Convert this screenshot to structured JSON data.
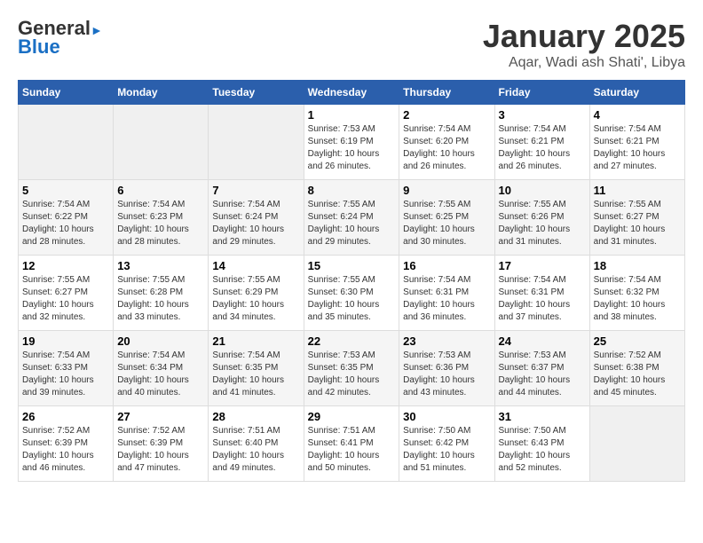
{
  "header": {
    "logo_line1": "General",
    "logo_line2": "Blue",
    "title": "January 2025",
    "subtitle": "Aqar, Wadi ash Shati', Libya"
  },
  "weekdays": [
    "Sunday",
    "Monday",
    "Tuesday",
    "Wednesday",
    "Thursday",
    "Friday",
    "Saturday"
  ],
  "weeks": [
    [
      {
        "day": "",
        "empty": true
      },
      {
        "day": "",
        "empty": true
      },
      {
        "day": "",
        "empty": true
      },
      {
        "day": "1",
        "sunrise": "7:53 AM",
        "sunset": "6:19 PM",
        "daylight": "10 hours and 26 minutes."
      },
      {
        "day": "2",
        "sunrise": "7:54 AM",
        "sunset": "6:20 PM",
        "daylight": "10 hours and 26 minutes."
      },
      {
        "day": "3",
        "sunrise": "7:54 AM",
        "sunset": "6:21 PM",
        "daylight": "10 hours and 26 minutes."
      },
      {
        "day": "4",
        "sunrise": "7:54 AM",
        "sunset": "6:21 PM",
        "daylight": "10 hours and 27 minutes."
      }
    ],
    [
      {
        "day": "5",
        "sunrise": "7:54 AM",
        "sunset": "6:22 PM",
        "daylight": "10 hours and 28 minutes."
      },
      {
        "day": "6",
        "sunrise": "7:54 AM",
        "sunset": "6:23 PM",
        "daylight": "10 hours and 28 minutes."
      },
      {
        "day": "7",
        "sunrise": "7:54 AM",
        "sunset": "6:24 PM",
        "daylight": "10 hours and 29 minutes."
      },
      {
        "day": "8",
        "sunrise": "7:55 AM",
        "sunset": "6:24 PM",
        "daylight": "10 hours and 29 minutes."
      },
      {
        "day": "9",
        "sunrise": "7:55 AM",
        "sunset": "6:25 PM",
        "daylight": "10 hours and 30 minutes."
      },
      {
        "day": "10",
        "sunrise": "7:55 AM",
        "sunset": "6:26 PM",
        "daylight": "10 hours and 31 minutes."
      },
      {
        "day": "11",
        "sunrise": "7:55 AM",
        "sunset": "6:27 PM",
        "daylight": "10 hours and 31 minutes."
      }
    ],
    [
      {
        "day": "12",
        "sunrise": "7:55 AM",
        "sunset": "6:27 PM",
        "daylight": "10 hours and 32 minutes."
      },
      {
        "day": "13",
        "sunrise": "7:55 AM",
        "sunset": "6:28 PM",
        "daylight": "10 hours and 33 minutes."
      },
      {
        "day": "14",
        "sunrise": "7:55 AM",
        "sunset": "6:29 PM",
        "daylight": "10 hours and 34 minutes."
      },
      {
        "day": "15",
        "sunrise": "7:55 AM",
        "sunset": "6:30 PM",
        "daylight": "10 hours and 35 minutes."
      },
      {
        "day": "16",
        "sunrise": "7:54 AM",
        "sunset": "6:31 PM",
        "daylight": "10 hours and 36 minutes."
      },
      {
        "day": "17",
        "sunrise": "7:54 AM",
        "sunset": "6:31 PM",
        "daylight": "10 hours and 37 minutes."
      },
      {
        "day": "18",
        "sunrise": "7:54 AM",
        "sunset": "6:32 PM",
        "daylight": "10 hours and 38 minutes."
      }
    ],
    [
      {
        "day": "19",
        "sunrise": "7:54 AM",
        "sunset": "6:33 PM",
        "daylight": "10 hours and 39 minutes."
      },
      {
        "day": "20",
        "sunrise": "7:54 AM",
        "sunset": "6:34 PM",
        "daylight": "10 hours and 40 minutes."
      },
      {
        "day": "21",
        "sunrise": "7:54 AM",
        "sunset": "6:35 PM",
        "daylight": "10 hours and 41 minutes."
      },
      {
        "day": "22",
        "sunrise": "7:53 AM",
        "sunset": "6:35 PM",
        "daylight": "10 hours and 42 minutes."
      },
      {
        "day": "23",
        "sunrise": "7:53 AM",
        "sunset": "6:36 PM",
        "daylight": "10 hours and 43 minutes."
      },
      {
        "day": "24",
        "sunrise": "7:53 AM",
        "sunset": "6:37 PM",
        "daylight": "10 hours and 44 minutes."
      },
      {
        "day": "25",
        "sunrise": "7:52 AM",
        "sunset": "6:38 PM",
        "daylight": "10 hours and 45 minutes."
      }
    ],
    [
      {
        "day": "26",
        "sunrise": "7:52 AM",
        "sunset": "6:39 PM",
        "daylight": "10 hours and 46 minutes."
      },
      {
        "day": "27",
        "sunrise": "7:52 AM",
        "sunset": "6:39 PM",
        "daylight": "10 hours and 47 minutes."
      },
      {
        "day": "28",
        "sunrise": "7:51 AM",
        "sunset": "6:40 PM",
        "daylight": "10 hours and 49 minutes."
      },
      {
        "day": "29",
        "sunrise": "7:51 AM",
        "sunset": "6:41 PM",
        "daylight": "10 hours and 50 minutes."
      },
      {
        "day": "30",
        "sunrise": "7:50 AM",
        "sunset": "6:42 PM",
        "daylight": "10 hours and 51 minutes."
      },
      {
        "day": "31",
        "sunrise": "7:50 AM",
        "sunset": "6:43 PM",
        "daylight": "10 hours and 52 minutes."
      },
      {
        "day": "",
        "empty": true
      }
    ]
  ],
  "labels": {
    "sunrise": "Sunrise:",
    "sunset": "Sunset:",
    "daylight": "Daylight:"
  }
}
